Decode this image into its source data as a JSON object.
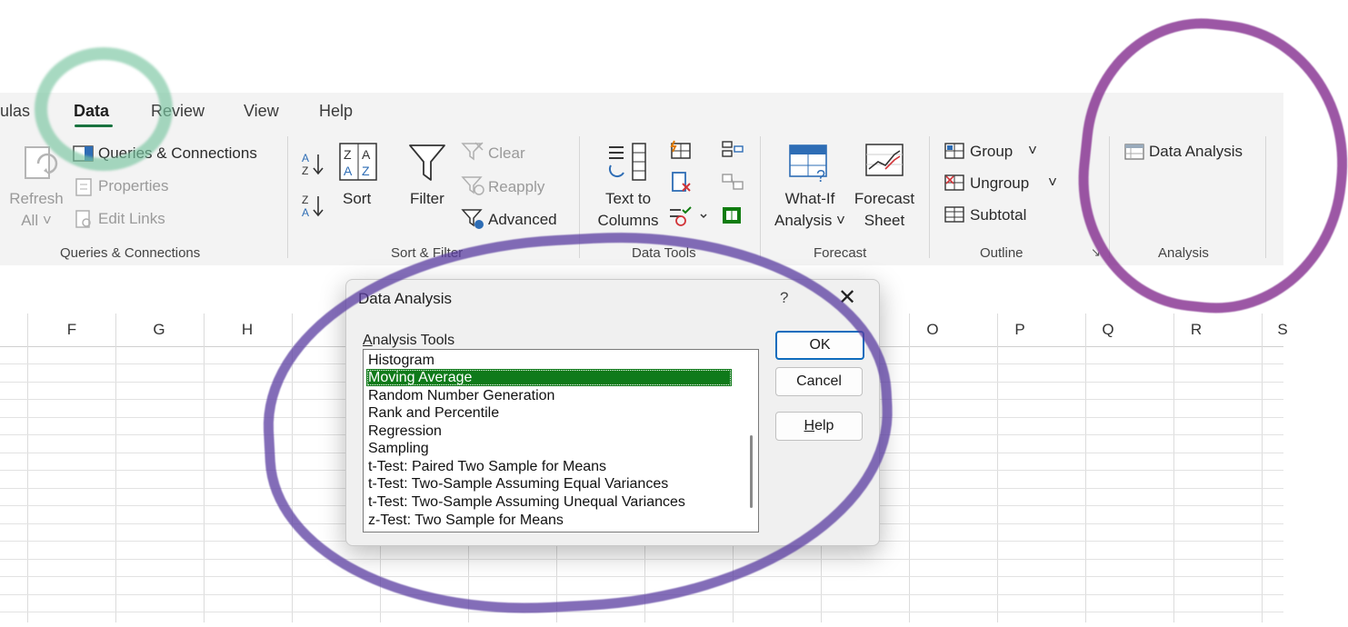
{
  "ribbon": {
    "tabs": [
      {
        "label": "ulas"
      },
      {
        "label": "Data"
      },
      {
        "label": "Review"
      },
      {
        "label": "View"
      },
      {
        "label": "Help"
      }
    ],
    "queries": {
      "refresh_line1": "Refresh",
      "refresh_line2": "All ˅",
      "queries_connections": "Queries & Connections",
      "properties": "Properties",
      "edit_links": "Edit Links",
      "group_label": "Queries & Connections"
    },
    "sort_filter": {
      "sort": "Sort",
      "filter": "Filter",
      "clear": "Clear",
      "reapply": "Reapply",
      "advanced": "Advanced",
      "group_label": "Sort & Filter"
    },
    "data_tools": {
      "text_to_columns_line1": "Text to",
      "text_to_columns_line2": "Columns",
      "group_label": "Data Tools"
    },
    "forecast": {
      "whatif_line1": "What-If",
      "whatif_line2": "Analysis ˅",
      "forecast_line1": "Forecast",
      "forecast_line2": "Sheet",
      "group_label": "Forecast"
    },
    "outline": {
      "group": "Group",
      "ungroup": "Ungroup",
      "subtotal": "Subtotal",
      "group_label": "Outline"
    },
    "analysis": {
      "data_analysis": "Data Analysis",
      "group_label": "Analysis"
    }
  },
  "sheet": {
    "columns": [
      "F",
      "G",
      "H",
      "O",
      "P",
      "Q",
      "R",
      "S"
    ]
  },
  "dialog": {
    "title": "Data Analysis",
    "help_glyph": "?",
    "close_glyph": "✕",
    "list_label_accel": "A",
    "list_label_rest": "nalysis Tools",
    "items": [
      "Histogram",
      "Moving Average",
      "Random Number Generation",
      "Rank and Percentile",
      "Regression",
      "Sampling",
      "t-Test: Paired Two Sample for Means",
      "t-Test: Two-Sample Assuming Equal Variances",
      "t-Test: Two-Sample Assuming Unequal Variances",
      "z-Test: Two Sample for Means"
    ],
    "selected_index": 1,
    "ok": "OK",
    "cancel": "Cancel",
    "help_accel": "H",
    "help_rest": "elp"
  },
  "colors": {
    "accent_green": "#1a7340",
    "selection_green": "#0f7a1a",
    "primary_blue": "#0f6cbd"
  }
}
